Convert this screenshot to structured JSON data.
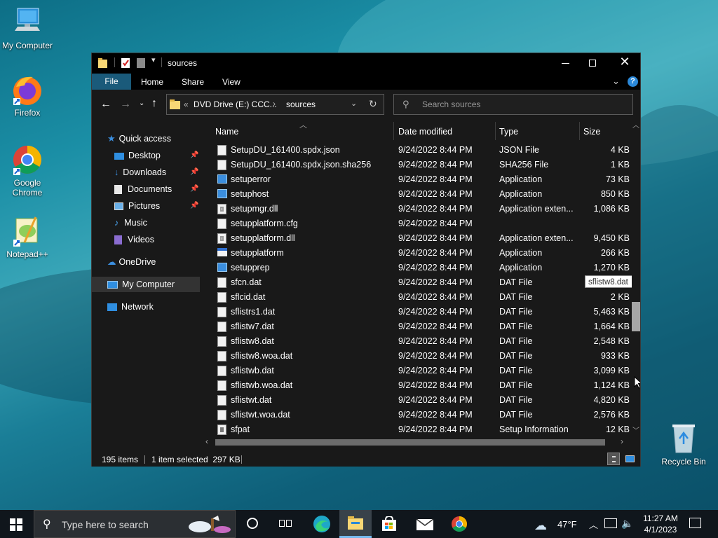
{
  "desktop": {
    "icons": [
      {
        "label": "My Computer"
      },
      {
        "label": "Firefox"
      },
      {
        "label": "Google Chrome"
      },
      {
        "label": "Notepad++"
      },
      {
        "label": "Recycle Bin"
      }
    ]
  },
  "window": {
    "title": "sources",
    "tabs": [
      "File",
      "Home",
      "Share",
      "View"
    ],
    "address": {
      "drive": "DVD Drive (E:) CCC...",
      "folder": "sources",
      "prefix": "«"
    },
    "search_placeholder": "Search sources",
    "nav": [
      {
        "label": "Quick access",
        "icon": "star-icon"
      },
      {
        "label": "Desktop",
        "icon": "desktop-icon",
        "pinned": true
      },
      {
        "label": "Downloads",
        "icon": "download-icon",
        "pinned": true
      },
      {
        "label": "Documents",
        "icon": "documents-icon",
        "pinned": true
      },
      {
        "label": "Pictures",
        "icon": "pictures-icon",
        "pinned": true
      },
      {
        "label": "Music",
        "icon": "music-icon"
      },
      {
        "label": "Videos",
        "icon": "videos-icon"
      },
      {
        "label": "OneDrive",
        "icon": "cloud-icon"
      },
      {
        "label": "My Computer",
        "icon": "computer-icon",
        "selected": true
      },
      {
        "label": "Network",
        "icon": "network-icon"
      }
    ],
    "columns": {
      "name": "Name",
      "date": "Date modified",
      "type": "Type",
      "size": "Size"
    },
    "files": [
      {
        "name": "SetupDU_161400.spdx.json",
        "date": "9/24/2022 8:44 PM",
        "type": "JSON File",
        "size": "4 KB",
        "icon": "doc"
      },
      {
        "name": "SetupDU_161400.spdx.json.sha256",
        "date": "9/24/2022 8:44 PM",
        "type": "SHA256 File",
        "size": "1 KB",
        "icon": "doc"
      },
      {
        "name": "setuperror",
        "date": "9/24/2022 8:44 PM",
        "type": "Application",
        "size": "73 KB",
        "icon": "app"
      },
      {
        "name": "setuphost",
        "date": "9/24/2022 8:44 PM",
        "type": "Application",
        "size": "850 KB",
        "icon": "app"
      },
      {
        "name": "setupmgr.dll",
        "date": "9/24/2022 8:44 PM",
        "type": "Application exten...",
        "size": "1,086 KB",
        "icon": "dll"
      },
      {
        "name": "setupplatform.cfg",
        "date": "9/24/2022 8:44 PM",
        "type": "",
        "size": "",
        "icon": "doc"
      },
      {
        "name": "setupplatform.dll",
        "date": "9/24/2022 8:44 PM",
        "type": "Application exten...",
        "size": "9,450 KB",
        "icon": "dll"
      },
      {
        "name": "setupplatform",
        "date": "9/24/2022 8:44 PM",
        "type": "Application",
        "size": "266 KB",
        "icon": "win"
      },
      {
        "name": "setupprep",
        "date": "9/24/2022 8:44 PM",
        "type": "Application",
        "size": "1,270 KB",
        "icon": "app"
      },
      {
        "name": "sfcn.dat",
        "date": "9/24/2022 8:44 PM",
        "type": "DAT File",
        "size": "2 KB",
        "icon": "doc"
      },
      {
        "name": "sflcid.dat",
        "date": "9/24/2022 8:44 PM",
        "type": "DAT File",
        "size": "2 KB",
        "icon": "doc"
      },
      {
        "name": "sflistrs1.dat",
        "date": "9/24/2022 8:44 PM",
        "type": "DAT File",
        "size": "5,463 KB",
        "icon": "doc"
      },
      {
        "name": "sflistw7.dat",
        "date": "9/24/2022 8:44 PM",
        "type": "DAT File",
        "size": "1,664 KB",
        "icon": "doc"
      },
      {
        "name": "sflistw8.dat",
        "date": "9/24/2022 8:44 PM",
        "type": "DAT File",
        "size": "2,548 KB",
        "icon": "doc"
      },
      {
        "name": "sflistw8.woa.dat",
        "date": "9/24/2022 8:44 PM",
        "type": "DAT File",
        "size": "933 KB",
        "icon": "doc"
      },
      {
        "name": "sflistwb.dat",
        "date": "9/24/2022 8:44 PM",
        "type": "DAT File",
        "size": "3,099 KB",
        "icon": "doc"
      },
      {
        "name": "sflistwb.woa.dat",
        "date": "9/24/2022 8:44 PM",
        "type": "DAT File",
        "size": "1,124 KB",
        "icon": "doc"
      },
      {
        "name": "sflistwt.dat",
        "date": "9/24/2022 8:44 PM",
        "type": "DAT File",
        "size": "4,820 KB",
        "icon": "doc"
      },
      {
        "name": "sflistwt.woa.dat",
        "date": "9/24/2022 8:44 PM",
        "type": "DAT File",
        "size": "2,576 KB",
        "icon": "doc"
      },
      {
        "name": "sfpat",
        "date": "9/24/2022 8:44 PM",
        "type": "Setup Information",
        "size": "12 KB",
        "icon": "inf"
      }
    ],
    "tooltip": "sflistw8.dat",
    "status": {
      "items": "195 items",
      "selected": "1 item selected  297 KB"
    }
  },
  "taskbar": {
    "search_placeholder": "Type here to search",
    "weather": "47°F",
    "time": "11:27 AM",
    "date": "4/1/2023"
  },
  "colors": {
    "accent": "#0078d7",
    "ribbon_file": "#1a4a66",
    "window_bg": "#191919",
    "taskbar": "#10161c"
  }
}
